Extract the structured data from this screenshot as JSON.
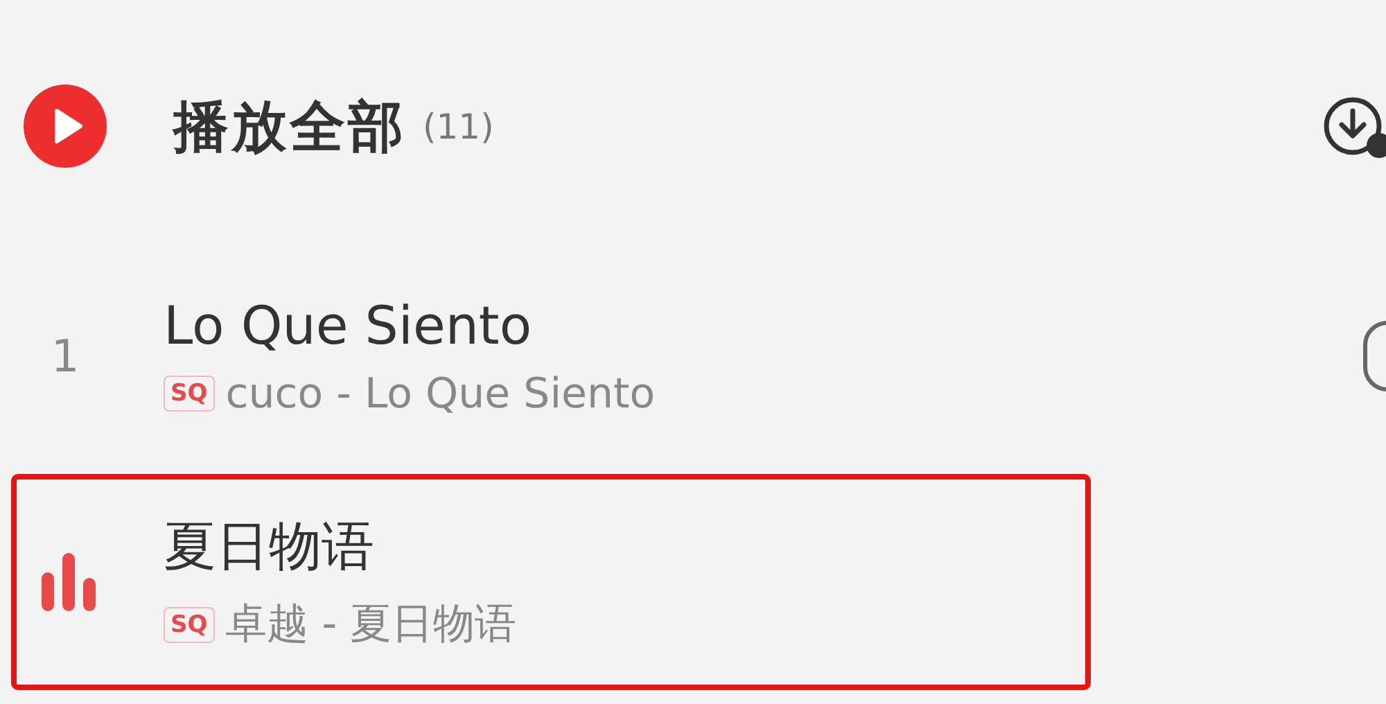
{
  "header": {
    "title": "播放全部",
    "count": "(11)"
  },
  "songs": [
    {
      "index": "1",
      "playing": false,
      "highlighted": false,
      "title": "Lo Que Siento",
      "quality": "SQ",
      "subtitle": "cuco - Lo Que Siento"
    },
    {
      "playing": true,
      "highlighted": true,
      "title": "夏日物语",
      "quality": "SQ",
      "subtitle": "卓越 - 夏日物语"
    }
  ]
}
